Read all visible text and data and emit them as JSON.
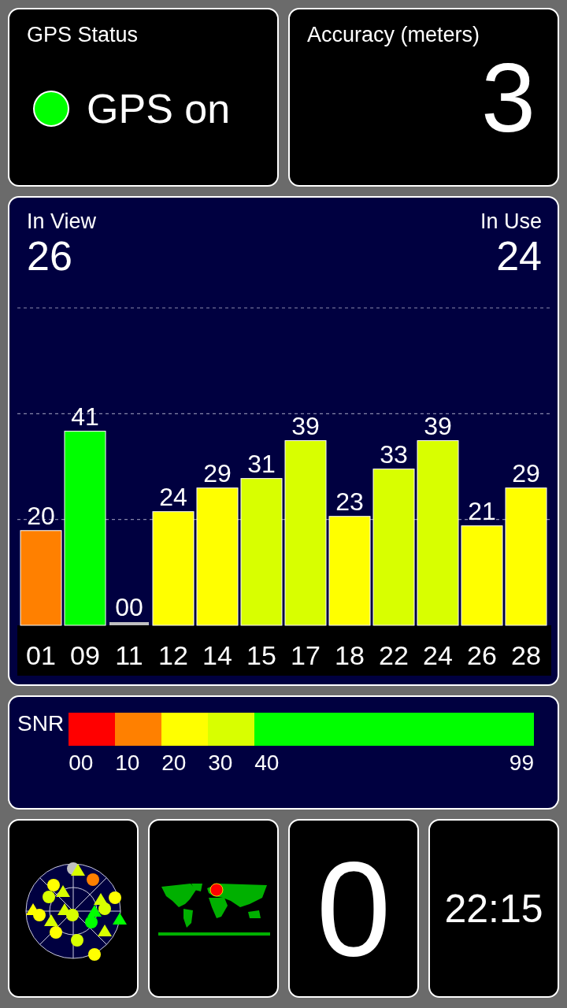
{
  "gps_status": {
    "title": "GPS Status",
    "status": "GPS on",
    "on": true
  },
  "accuracy": {
    "title": "Accuracy (meters)",
    "value": "3"
  },
  "satellites": {
    "in_view_label": "In View",
    "in_view": "26",
    "in_use_label": "In Use",
    "in_use": "24",
    "chart_data": {
      "type": "bar",
      "categories": [
        "01",
        "09",
        "11",
        "12",
        "14",
        "15",
        "17",
        "18",
        "22",
        "24",
        "26",
        "28"
      ],
      "values": [
        20,
        41,
        0,
        24,
        29,
        31,
        39,
        23,
        33,
        39,
        21,
        29
      ],
      "value_labels": [
        "20",
        "41",
        "00",
        "24",
        "29",
        "31",
        "39",
        "23",
        "33",
        "39",
        "21",
        "29"
      ]
    }
  },
  "snr_legend": {
    "label": "SNR",
    "segments": [
      {
        "label": "00",
        "color": "#ff0000"
      },
      {
        "label": "10",
        "color": "#ff8000"
      },
      {
        "label": "20",
        "color": "#ffff00"
      },
      {
        "label": "30",
        "color": "#d8ff00"
      },
      {
        "label": "40",
        "color": "#00ff00"
      }
    ],
    "end_label": "99"
  },
  "tiles": [
    {
      "kind": "sky_plot"
    },
    {
      "kind": "world_map"
    },
    {
      "kind": "count",
      "value": "0"
    },
    {
      "kind": "clock",
      "value": "22:15"
    }
  ]
}
